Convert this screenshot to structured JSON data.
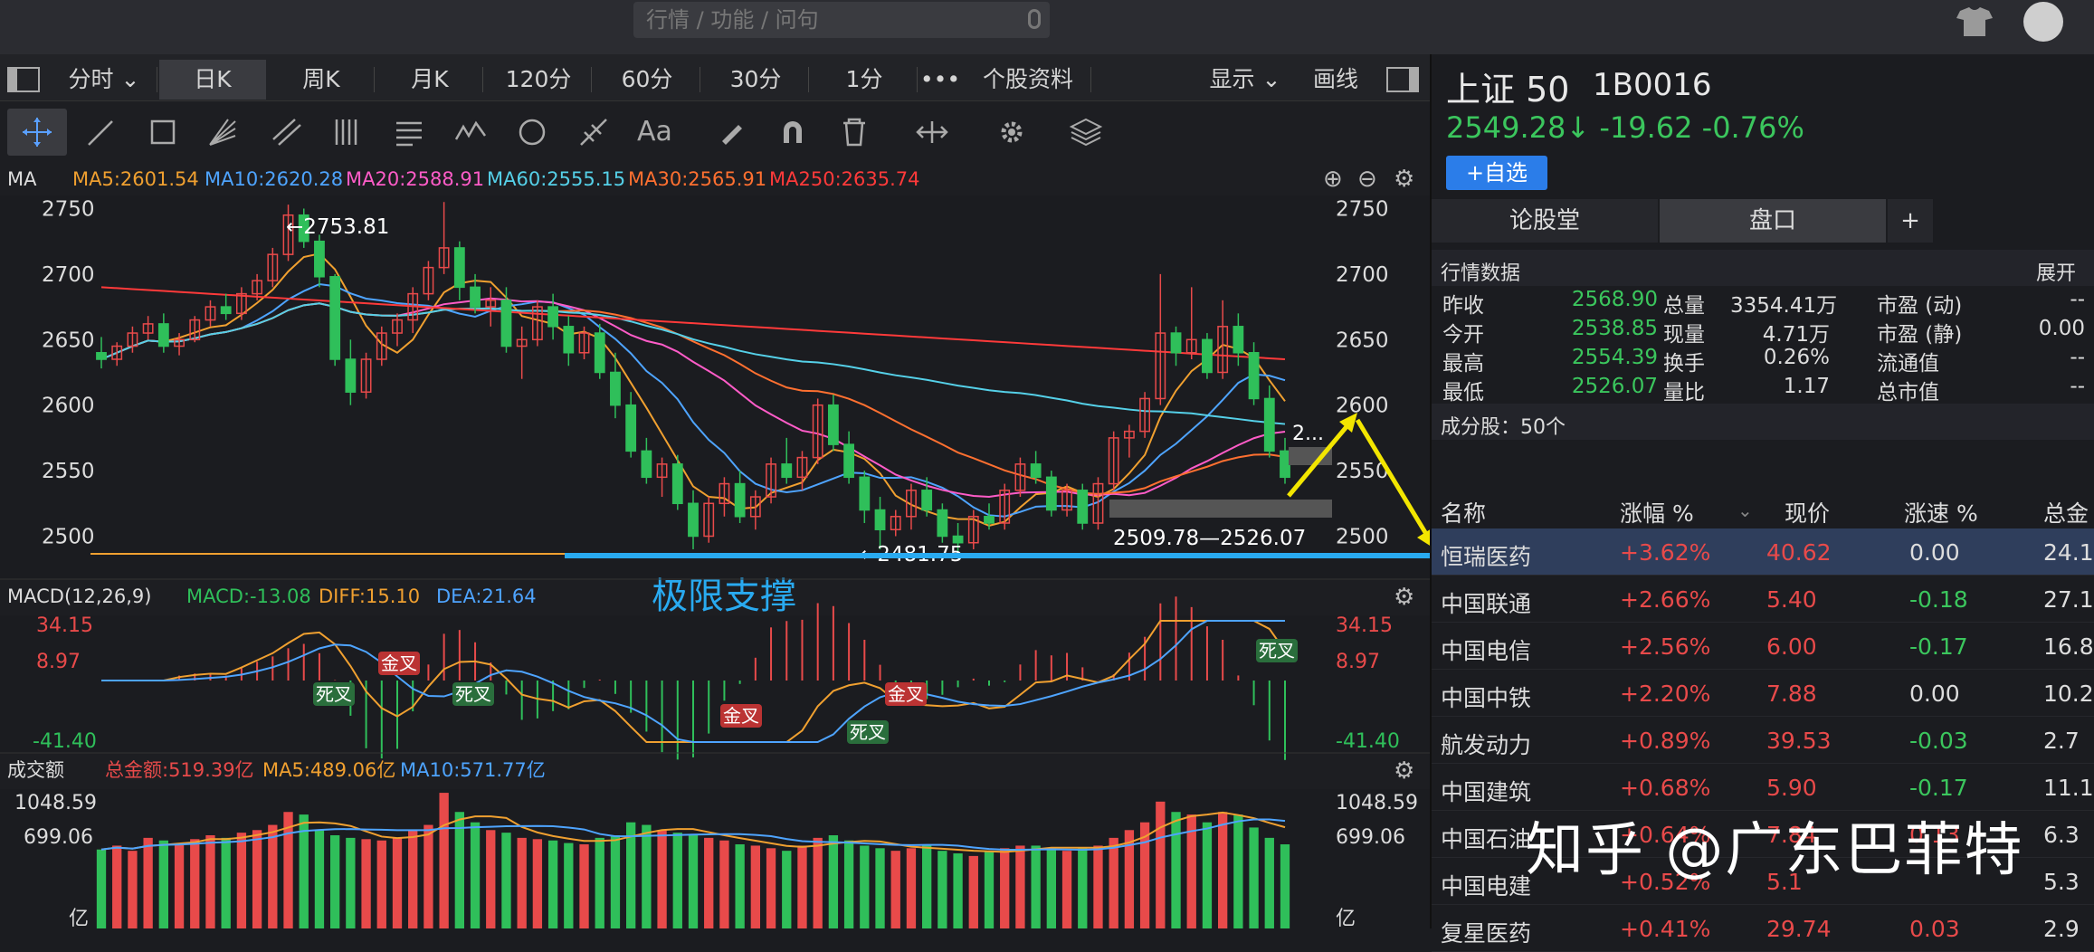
{
  "search": {
    "placeholder": "行情 / 功能 / 问句"
  },
  "tabs": [
    "分时",
    "日K",
    "周K",
    "月K",
    "120分",
    "60分",
    "30分",
    "1分",
    "•••",
    "个股资料"
  ],
  "tabs_right": {
    "display": "显示",
    "draw": "画线"
  },
  "ma_line": {
    "label": "MA",
    "ma5": "MA5:2601.54",
    "ma10": "MA10:2620.28",
    "ma20": "MA20:2588.91",
    "ma60": "MA60:2555.15",
    "ma30": "MA30:2565.91",
    "ma250": "MA250:2635.74"
  },
  "macd_line": {
    "label": "MACD(12,26,9)",
    "macd": "MACD:-13.08",
    "diff": "DIFF:15.10",
    "dea": "DEA:21.64"
  },
  "vol_line": {
    "label": "成交额",
    "total": "总金额:519.39亿",
    "ma5": "MA5:489.06亿",
    "ma10": "MA10:571.77亿"
  },
  "main_axis": {
    "ticks": [
      "2750",
      "2700",
      "2650",
      "2600",
      "2550",
      "2500"
    ],
    "right_ticks": [
      "2750",
      "2700",
      "2650",
      "2600",
      "2550",
      "2500"
    ]
  },
  "macd_axis": {
    "ticks": [
      "34.15",
      "8.97",
      "-41.40"
    ]
  },
  "vol_axis": {
    "ticks": [
      "1048.59",
      "699.06",
      "亿"
    ]
  },
  "annotations": {
    "high": "←2753.81",
    "low": "←2481.75",
    "range": "2509.78—2526.07",
    "short": "2...",
    "support": "极限支撑",
    "jincha": "金叉",
    "sicha": "死叉"
  },
  "colors": {
    "up": "#e84a4a",
    "down": "#2fbf5a",
    "ma5": "#f0a030",
    "ma10": "#4ea4ff",
    "ma20": "#ff5cc8",
    "ma30": "#ff7030",
    "ma60": "#55d0e8",
    "ma250": "#ff3a3a",
    "support": "#29aaf0",
    "arrow": "#f3e600"
  },
  "right": {
    "title": "上证 50",
    "code": "1B0016",
    "price": "2549.28↓ -19.62 -0.76%",
    "add": "+自选",
    "tabs": [
      "论股堂",
      "盘口",
      "+"
    ],
    "section": "行情数据",
    "expand": "展开",
    "quote": [
      [
        "昨收",
        "2568.90",
        "总量",
        "3354.41万",
        "市盈 (动)",
        "--"
      ],
      [
        "今开",
        "2538.85",
        "现量",
        "4.71万",
        "市盈 (静)",
        "0.00"
      ],
      [
        "最高",
        "2554.39",
        "换手",
        "0.26%",
        "流通值",
        "--"
      ],
      [
        "最低",
        "2526.07",
        "量比",
        "1.17",
        "总市值",
        "--"
      ]
    ],
    "constituents": "成分股：50个",
    "headers": [
      "名称",
      "涨幅 %",
      "现价",
      "涨速 %",
      "总金"
    ],
    "rows": [
      [
        "恒瑞医药",
        "+3.62%",
        "40.62",
        "0.00",
        "24.1"
      ],
      [
        "中国联通",
        "+2.66%",
        "5.40",
        "-0.18",
        "27.1"
      ],
      [
        "中国电信",
        "+2.56%",
        "6.00",
        "-0.17",
        "16.8"
      ],
      [
        "中国中铁",
        "+2.20%",
        "7.88",
        "0.00",
        "10.2"
      ],
      [
        "航发动力",
        "+0.89%",
        "39.53",
        "-0.03",
        "2.7"
      ],
      [
        "中国建筑",
        "+0.68%",
        "5.90",
        "-0.17",
        "11.1"
      ],
      [
        "中国石油",
        "+0.64%",
        "7.84",
        "0.13",
        "6.3"
      ],
      [
        "中国电建",
        "+0.52%",
        "5.1",
        "",
        "5.3"
      ],
      [
        "复星医药",
        "+0.41%",
        "29.74",
        "0.03",
        "2.9"
      ]
    ]
  },
  "watermark": "知乎 @广东巴菲特",
  "chart_data": {
    "type": "candlestick",
    "ylim": [
      2481,
      2760
    ],
    "ohlc": [
      [
        2640,
        2652,
        2628,
        2635
      ],
      [
        2635,
        2648,
        2630,
        2645
      ],
      [
        2645,
        2660,
        2640,
        2655
      ],
      [
        2655,
        2668,
        2650,
        2662
      ],
      [
        2662,
        2670,
        2640,
        2645
      ],
      [
        2645,
        2655,
        2638,
        2650
      ],
      [
        2650,
        2668,
        2648,
        2665
      ],
      [
        2665,
        2680,
        2660,
        2675
      ],
      [
        2675,
        2685,
        2665,
        2670
      ],
      [
        2670,
        2690,
        2665,
        2685
      ],
      [
        2685,
        2700,
        2680,
        2695
      ],
      [
        2695,
        2720,
        2690,
        2715
      ],
      [
        2715,
        2753,
        2710,
        2745
      ],
      [
        2745,
        2750,
        2720,
        2725
      ],
      [
        2725,
        2730,
        2690,
        2698
      ],
      [
        2698,
        2700,
        2630,
        2635
      ],
      [
        2635,
        2650,
        2600,
        2610
      ],
      [
        2610,
        2640,
        2605,
        2635
      ],
      [
        2635,
        2660,
        2630,
        2655
      ],
      [
        2655,
        2670,
        2645,
        2665
      ],
      [
        2665,
        2690,
        2655,
        2685
      ],
      [
        2685,
        2710,
        2680,
        2705
      ],
      [
        2705,
        2755,
        2700,
        2720
      ],
      [
        2720,
        2725,
        2680,
        2690
      ],
      [
        2690,
        2700,
        2670,
        2675
      ],
      [
        2675,
        2690,
        2660,
        2680
      ],
      [
        2680,
        2690,
        2640,
        2645
      ],
      [
        2645,
        2660,
        2620,
        2650
      ],
      [
        2650,
        2680,
        2645,
        2675
      ],
      [
        2675,
        2685,
        2650,
        2660
      ],
      [
        2660,
        2668,
        2630,
        2640
      ],
      [
        2640,
        2660,
        2635,
        2655
      ],
      [
        2655,
        2662,
        2620,
        2625
      ],
      [
        2625,
        2640,
        2590,
        2600
      ],
      [
        2600,
        2610,
        2560,
        2565
      ],
      [
        2565,
        2575,
        2540,
        2545
      ],
      [
        2545,
        2560,
        2530,
        2555
      ],
      [
        2555,
        2562,
        2520,
        2525
      ],
      [
        2525,
        2535,
        2490,
        2500
      ],
      [
        2500,
        2530,
        2495,
        2525
      ],
      [
        2525,
        2545,
        2515,
        2540
      ],
      [
        2540,
        2550,
        2510,
        2515
      ],
      [
        2515,
        2535,
        2505,
        2530
      ],
      [
        2530,
        2560,
        2525,
        2555
      ],
      [
        2555,
        2575,
        2540,
        2545
      ],
      [
        2545,
        2565,
        2535,
        2560
      ],
      [
        2560,
        2605,
        2555,
        2600
      ],
      [
        2600,
        2608,
        2565,
        2570
      ],
      [
        2570,
        2580,
        2540,
        2545
      ],
      [
        2545,
        2550,
        2510,
        2520
      ],
      [
        2520,
        2530,
        2490,
        2505
      ],
      [
        2505,
        2520,
        2500,
        2515
      ],
      [
        2515,
        2540,
        2505,
        2535
      ],
      [
        2535,
        2545,
        2515,
        2520
      ],
      [
        2520,
        2525,
        2495,
        2500
      ],
      [
        2500,
        2510,
        2485,
        2495
      ],
      [
        2495,
        2520,
        2490,
        2515
      ],
      [
        2515,
        2525,
        2505,
        2510
      ],
      [
        2510,
        2540,
        2505,
        2535
      ],
      [
        2535,
        2560,
        2530,
        2555
      ],
      [
        2555,
        2565,
        2540,
        2545
      ],
      [
        2545,
        2550,
        2515,
        2520
      ],
      [
        2520,
        2540,
        2515,
        2535
      ],
      [
        2535,
        2540,
        2505,
        2510
      ],
      [
        2510,
        2545,
        2505,
        2540
      ],
      [
        2540,
        2580,
        2535,
        2575
      ],
      [
        2575,
        2585,
        2560,
        2580
      ],
      [
        2580,
        2610,
        2575,
        2605
      ],
      [
        2605,
        2700,
        2600,
        2655
      ],
      [
        2655,
        2660,
        2630,
        2640
      ],
      [
        2640,
        2690,
        2635,
        2650
      ],
      [
        2650,
        2655,
        2620,
        2625
      ],
      [
        2625,
        2680,
        2620,
        2660
      ],
      [
        2660,
        2670,
        2630,
        2640
      ],
      [
        2640,
        2648,
        2600,
        2605
      ],
      [
        2605,
        2615,
        2560,
        2565
      ],
      [
        2565,
        2575,
        2540,
        2545
      ]
    ],
    "volume": [
      610,
      640,
      600,
      700,
      680,
      660,
      690,
      720,
      700,
      740,
      760,
      800,
      900,
      880,
      760,
      720,
      700,
      690,
      680,
      700,
      760,
      800,
      1048,
      900,
      820,
      760,
      740,
      700,
      690,
      680,
      660,
      650,
      700,
      720,
      820,
      800,
      760,
      740,
      720,
      700,
      680,
      650,
      640,
      620,
      600,
      640,
      700,
      720,
      680,
      640,
      620,
      600,
      620,
      640,
      600,
      580,
      560,
      600,
      620,
      640,
      640,
      620,
      600,
      620,
      640,
      700,
      760,
      820,
      980,
      900,
      880,
      820,
      900,
      880,
      780,
      700,
      650
    ]
  }
}
